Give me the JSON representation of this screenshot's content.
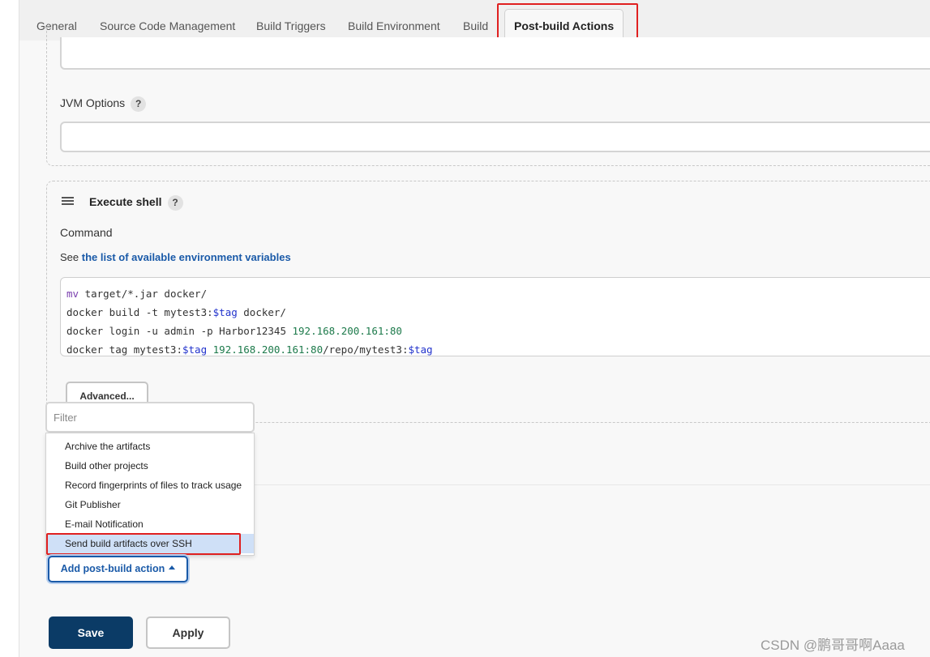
{
  "tabs": [
    {
      "label": "General"
    },
    {
      "label": "Source Code Management"
    },
    {
      "label": "Build Triggers"
    },
    {
      "label": "Build Environment"
    },
    {
      "label": "Build"
    },
    {
      "label": "Post-build Actions"
    }
  ],
  "jvm": {
    "label": "JVM Options",
    "help": "?"
  },
  "execute_shell": {
    "title": "Execute shell",
    "help": "?",
    "command_label": "Command",
    "env_prefix": "See ",
    "env_link": "the list of available environment variables",
    "advanced_label": "Advanced..."
  },
  "code": {
    "line1": {
      "a": "mv",
      "b": " target/*.jar docker/"
    },
    "line2": {
      "a": "docker build ",
      "b": "-t",
      "c": " mytest3:",
      "d": "$tag",
      "e": " docker/"
    },
    "line3": {
      "a": "docker login ",
      "b": "-u",
      "c": " admin ",
      "d": "-p",
      "e": " Harbor12345 ",
      "f": "192.168.200.161:80"
    },
    "line4": {
      "a": "docker tag mytest3:",
      "b": "$tag",
      "c": " ",
      "d": "192.168.200.161:80",
      "e": "/repo/mytest3:",
      "f": "$tag"
    }
  },
  "dropdown": {
    "filter_placeholder": "Filter",
    "items": [
      {
        "label": "Archive the artifacts"
      },
      {
        "label": "Build other projects"
      },
      {
        "label": "Record fingerprints of files to track usage"
      },
      {
        "label": "Git Publisher"
      },
      {
        "label": "E-mail Notification"
      },
      {
        "label": "Send build artifacts over SSH"
      }
    ]
  },
  "add_action_label": "Add post-build action",
  "footer": {
    "save_label": "Save",
    "apply_label": "Apply"
  },
  "watermark": "CSDN @鹏哥哥啊Aaaa",
  "colors": {
    "accent": "#1a5aa8",
    "save_bg": "#0b3b66",
    "highlight": "#e02020"
  }
}
